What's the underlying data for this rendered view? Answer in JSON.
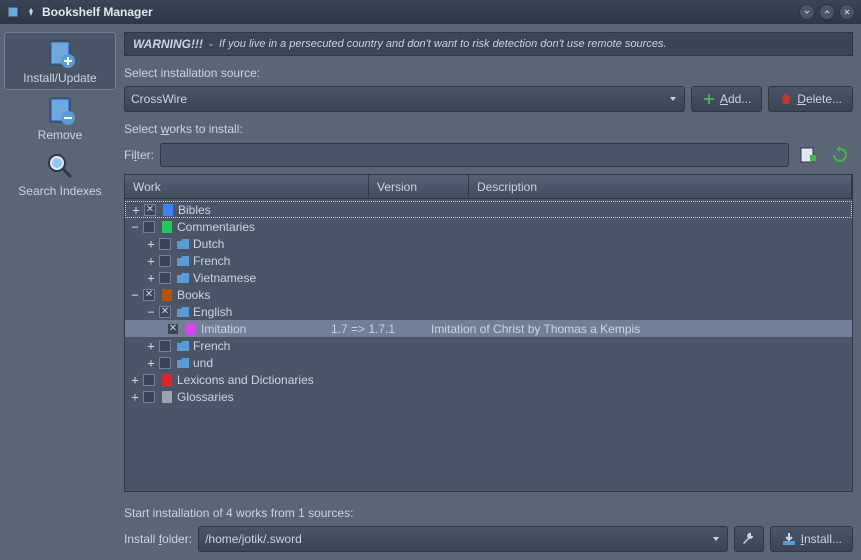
{
  "title": "Bookshelf Manager",
  "sidebar": {
    "items": [
      {
        "label": "Install/Update"
      },
      {
        "label": "Remove"
      },
      {
        "label": "Search Indexes"
      }
    ]
  },
  "warning": {
    "title": "WARNING!!!",
    "sep": "-",
    "text": "If you live in a persecuted country and don't want to risk detection don't use remote sources."
  },
  "labels": {
    "select_source": "Select installation source:",
    "select_works": "Select works to install:",
    "filter": "Filter:",
    "status": "Start installation of 4 works from 1 sources:",
    "install_folder": "Install folder:"
  },
  "source": {
    "value": "CrossWire"
  },
  "buttons": {
    "add": "Add...",
    "delete": "Delete...",
    "install": "Install..."
  },
  "columns": {
    "work": "Work",
    "version": "Version",
    "description": "Description"
  },
  "tree": {
    "bibles": "Bibles",
    "commentaries": "Commentaries",
    "dutch": "Dutch",
    "french": "French",
    "vietnamese": "Vietnamese",
    "books": "Books",
    "english": "English",
    "imitation": "Imitation",
    "imitation_version": "1.7 => 1.7.1",
    "imitation_desc": "Imitation of Christ by Thomas a Kempis",
    "und": "und",
    "lexicons": "Lexicons and Dictionaries",
    "glossaries": "Glossaries"
  },
  "install_folder": {
    "value": "/home/jotik/.sword"
  }
}
